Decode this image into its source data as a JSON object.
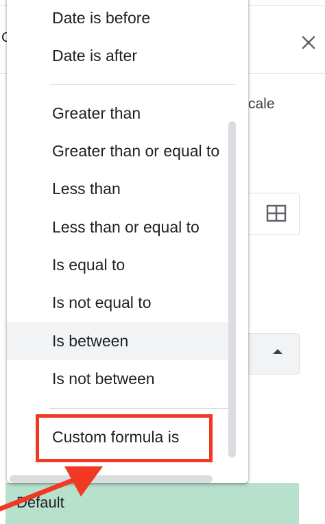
{
  "background_panel": {
    "title_fragment": "C",
    "color_scale_fragment": "cale",
    "preview_label": "Default",
    "preview_color": "#b7e1cd"
  },
  "menu": {
    "items_top": [
      {
        "label": "Date is before"
      },
      {
        "label": "Date is after"
      }
    ],
    "items_number": [
      {
        "label": "Greater than"
      },
      {
        "label": "Greater than or equal to"
      },
      {
        "label": "Less than"
      },
      {
        "label": "Less than or equal to"
      },
      {
        "label": "Is equal to"
      },
      {
        "label": "Is not equal to"
      },
      {
        "label": "Is between",
        "hovered": true
      },
      {
        "label": "Is not between"
      }
    ],
    "items_bottom": [
      {
        "label": "Custom formula is",
        "highlighted": true
      }
    ]
  },
  "icons": {
    "close": "close-icon",
    "range": "grid-icon",
    "caret": "caret-up-icon"
  },
  "annotation": {
    "color": "#f03823"
  }
}
